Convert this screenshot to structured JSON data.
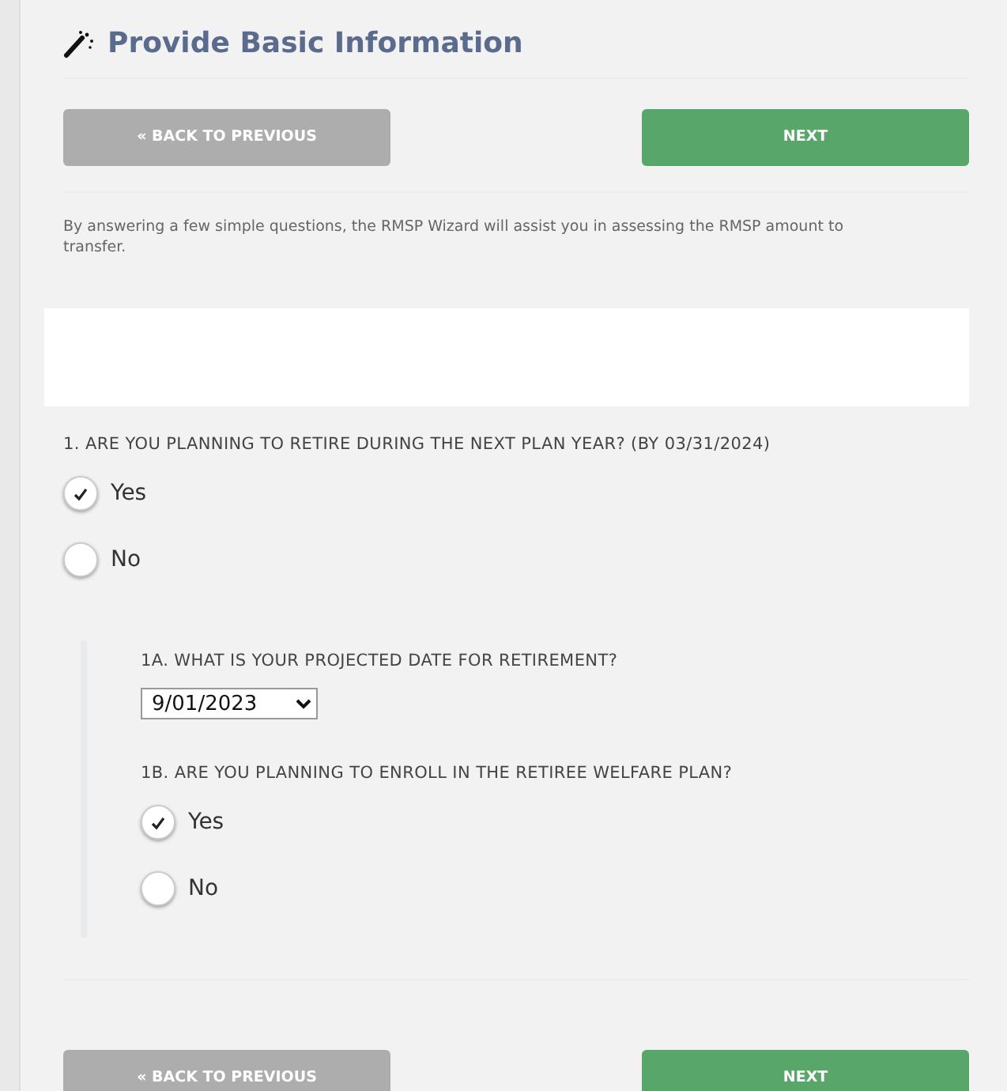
{
  "header": {
    "title": "Provide Basic Information"
  },
  "nav_top": [
    {
      "kind": "back",
      "label": "« BACK TO PREVIOUS"
    },
    {
      "kind": "next",
      "label": "NEXT"
    }
  ],
  "intro": "By answering a few simple questions, the RMSP Wizard will assist you in assessing the RMSP amount to transfer.",
  "questions": [
    {
      "label": "1. ARE YOU PLANNING TO RETIRE DURING THE NEXT PLAN YEAR? (BY 03/31/2024)",
      "options": [
        {
          "label": "Yes",
          "selected": true
        },
        {
          "label": "No",
          "selected": false
        }
      ],
      "sub_questions": [
        {
          "kind": "select",
          "label": "1A. WHAT IS YOUR PROJECTED DATE FOR RETIREMENT?",
          "value": "9/01/2023"
        },
        {
          "kind": "radio",
          "label": "1B. ARE YOU PLANNING TO ENROLL IN THE RETIREE WELFARE PLAN?",
          "options": [
            {
              "label": "Yes",
              "selected": true
            },
            {
              "label": "No",
              "selected": false
            }
          ]
        }
      ]
    }
  ],
  "nav_bottom": [
    {
      "kind": "back",
      "label": "« BACK TO PREVIOUS"
    },
    {
      "kind": "next",
      "label": "NEXT"
    }
  ]
}
